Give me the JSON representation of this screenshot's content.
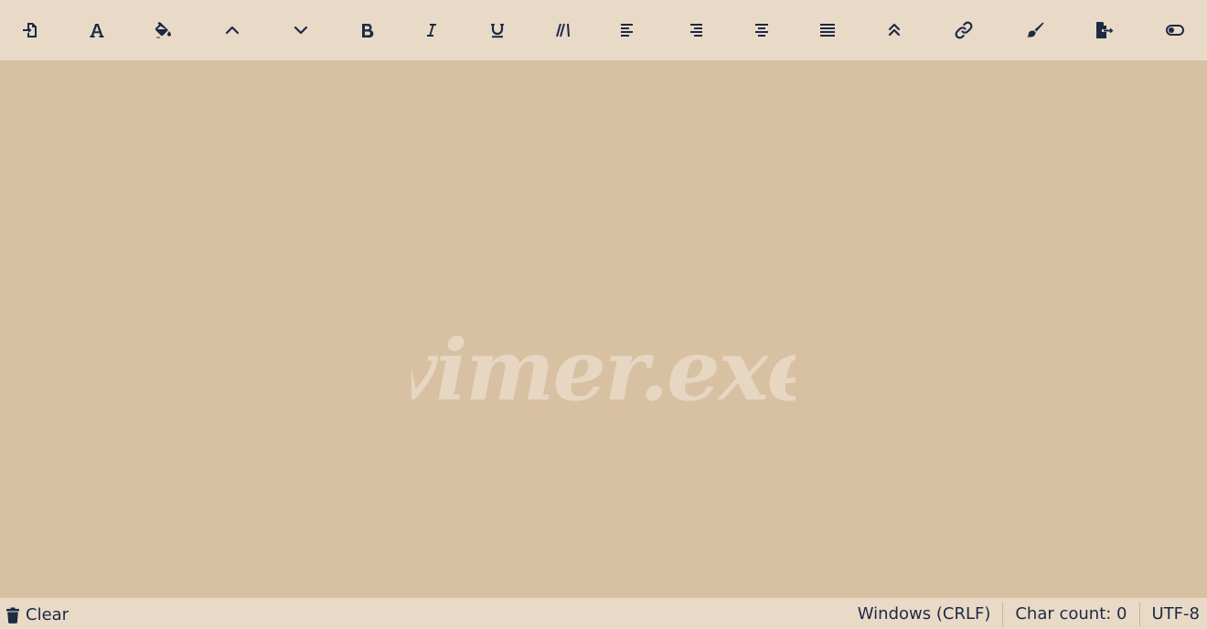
{
  "colors": {
    "toolbar_bg": "#e9dac7",
    "editor_bg": "#d8c0a2",
    "icon": "#1c2a44",
    "watermark": "#e6d6c2"
  },
  "toolbar": {
    "tools": [
      {
        "icon": "file-import-icon",
        "label": "Open file"
      },
      {
        "icon": "font-icon",
        "label": "Font"
      },
      {
        "icon": "fill-drip-icon",
        "label": "Color"
      },
      {
        "icon": "chevron-up-icon",
        "label": "Increase font size"
      },
      {
        "icon": "chevron-down-icon",
        "label": "Decrease font size"
      },
      {
        "icon": "bold-icon",
        "label": "Bold"
      },
      {
        "icon": "italic-icon",
        "label": "Italic"
      },
      {
        "icon": "underline-icon",
        "label": "Underline"
      },
      {
        "icon": "strikethrough-lines-icon",
        "label": "Slant"
      },
      {
        "icon": "align-left-icon",
        "label": "Align left"
      },
      {
        "icon": "align-right-icon",
        "label": "Align right"
      },
      {
        "icon": "align-center-icon",
        "label": "Align center"
      },
      {
        "icon": "align-justify-icon",
        "label": "Justify"
      },
      {
        "icon": "double-chevron-up-icon",
        "label": "Uppercase"
      },
      {
        "icon": "link-icon",
        "label": "Link"
      },
      {
        "icon": "brush-icon",
        "label": "Clear formatting"
      },
      {
        "icon": "file-export-icon",
        "label": "Save file"
      },
      {
        "icon": "toggle-icon",
        "label": "Toggle theme"
      }
    ]
  },
  "editor": {
    "watermark_text": "vimer.exe",
    "content": ""
  },
  "statusbar": {
    "clear_label": "Clear",
    "line_ending": "Windows (CRLF)",
    "char_count": "Char count: 0",
    "encoding": "UTF-8"
  }
}
